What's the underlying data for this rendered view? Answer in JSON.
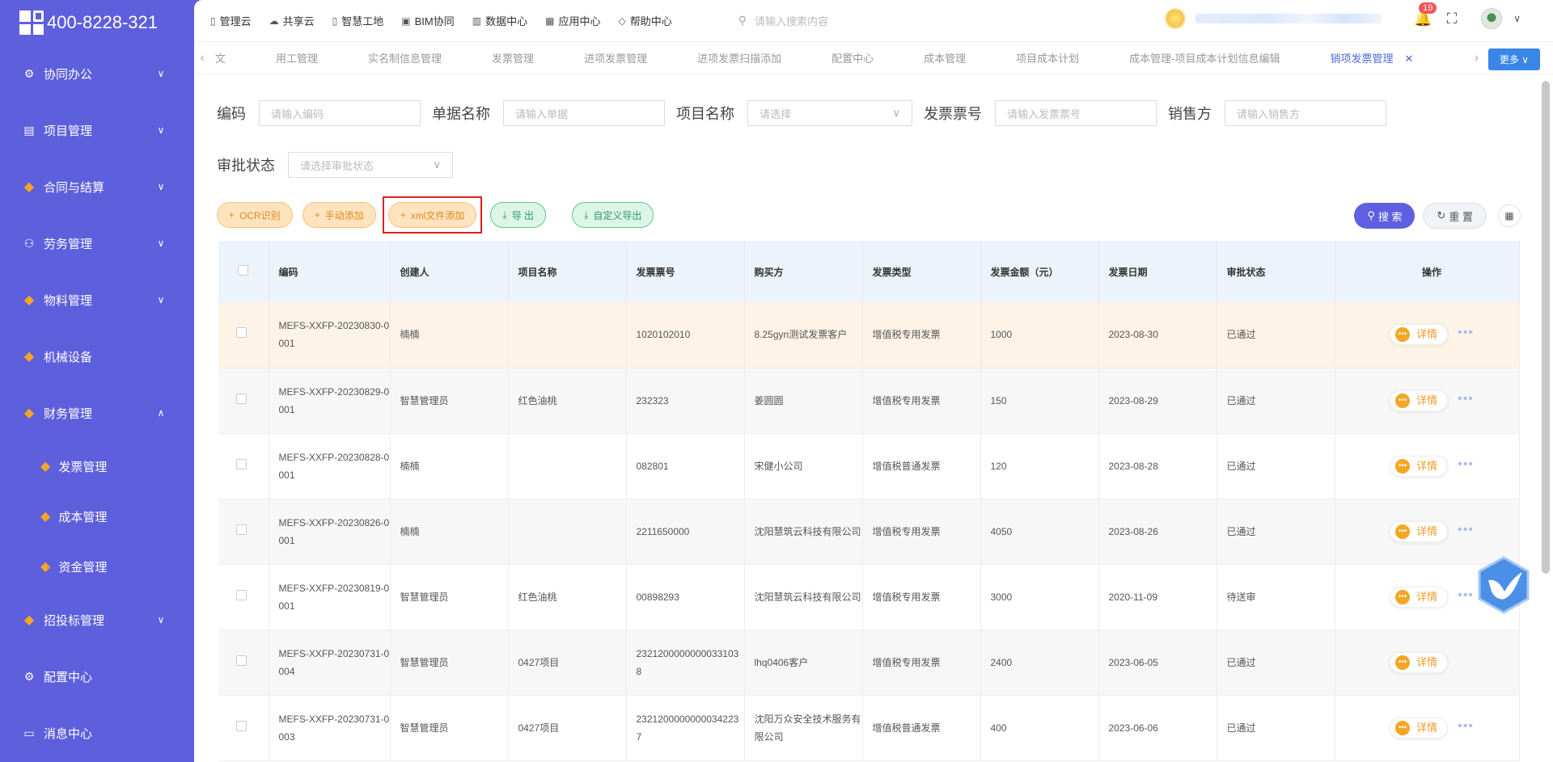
{
  "brand": {
    "phone": "400-8228-321"
  },
  "sidebar": {
    "items": [
      {
        "label": "协同办公",
        "icon": "gear-icon",
        "chevron": "down"
      },
      {
        "label": "项目管理",
        "icon": "book-icon",
        "chevron": "down"
      },
      {
        "label": "合同与结算",
        "icon": "gem-icon",
        "chevron": "down"
      },
      {
        "label": "劳务管理",
        "icon": "user-icon",
        "chevron": "down"
      },
      {
        "label": "物料管理",
        "icon": "gem-icon",
        "chevron": "down"
      },
      {
        "label": "机械设备",
        "icon": "gem-icon",
        "chevron": ""
      },
      {
        "label": "财务管理",
        "icon": "gem-icon",
        "chevron": "up"
      }
    ],
    "subitems": [
      {
        "label": "发票管理"
      },
      {
        "label": "成本管理"
      },
      {
        "label": "资金管理"
      }
    ],
    "bottom_items": [
      {
        "label": "招投标管理",
        "icon": "gem-icon",
        "chevron": "down"
      },
      {
        "label": "配置中心",
        "icon": "gear-icon",
        "chevron": ""
      },
      {
        "label": "消息中心",
        "icon": "chat-icon",
        "chevron": ""
      }
    ]
  },
  "topbar": {
    "links": [
      {
        "label": "管理云",
        "icon": "doc-icon"
      },
      {
        "label": "共享云",
        "icon": "cloud-icon"
      },
      {
        "label": "智慧工地",
        "icon": "doc-icon"
      },
      {
        "label": "BIM协同",
        "icon": "cube-icon"
      },
      {
        "label": "数据中心",
        "icon": "chart-icon"
      },
      {
        "label": "应用中心",
        "icon": "grid-icon"
      },
      {
        "label": "帮助中心",
        "icon": "diamond-icon"
      }
    ],
    "search_placeholder": "请输入搜索内容",
    "notification_count": "19"
  },
  "tabs": {
    "items": [
      "文",
      "用工管理",
      "实名制信息管理",
      "发票管理",
      "进项发票管理",
      "进项发票扫描添加",
      "配置中心",
      "成本管理",
      "项目成本计划",
      "成本管理-项目成本计划信息编辑"
    ],
    "active": "销项发票管理",
    "more_label": "更多"
  },
  "filters": {
    "code_label": "编码",
    "code_placeholder": "请输入编码",
    "docname_label": "单据名称",
    "docname_placeholder": "请输入单据",
    "project_label": "项目名称",
    "project_placeholder": "请选择",
    "invoice_label": "发票票号",
    "invoice_placeholder": "请输入发票票号",
    "seller_label": "销售方",
    "seller_placeholder": "请输入销售方",
    "status_label": "审批状态",
    "status_placeholder": "请选择审批状态"
  },
  "toolbar": {
    "ocr": "OCR识别",
    "manual": "手动添加",
    "xml": "xml文件添加",
    "export": "导 出",
    "custom_export": "自定义导出",
    "search": "搜 索",
    "reset": "重 置"
  },
  "table": {
    "headers": [
      "编码",
      "创建人",
      "项目名称",
      "发票票号",
      "购买方",
      "发票类型",
      "发票金额（元）",
      "发票日期",
      "审批状态",
      "操作"
    ],
    "detail_label": "详情",
    "rows": [
      {
        "code": "MEFS-XXFP-20230830-0001",
        "creator": "楠楠",
        "project": "",
        "invoice": "1020102010",
        "buyer": "8.25gyn测试发票客户",
        "type": "增值税专用发票",
        "amount": "1000",
        "date": "2023-08-30",
        "status": "已通过"
      },
      {
        "code": "MEFS-XXFP-20230829-0001",
        "creator": "智慧管理员",
        "project": "红色油桃",
        "invoice": "232323",
        "buyer": "姜圆圆",
        "type": "增值税专用发票",
        "amount": "150",
        "date": "2023-08-29",
        "status": "已通过"
      },
      {
        "code": "MEFS-XXFP-20230828-0001",
        "creator": "楠楠",
        "project": "",
        "invoice": "082801",
        "buyer": "宋健小公司",
        "type": "增值税普通发票",
        "amount": "120",
        "date": "2023-08-28",
        "status": "已通过"
      },
      {
        "code": "MEFS-XXFP-20230826-0001",
        "creator": "楠楠",
        "project": "",
        "invoice": "2211650000",
        "buyer": "沈阳慧筑云科技有限公司",
        "type": "增值税专用发票",
        "amount": "4050",
        "date": "2023-08-26",
        "status": "已通过"
      },
      {
        "code": "MEFS-XXFP-20230819-0001",
        "creator": "智慧管理员",
        "project": "红色油桃",
        "invoice": "00898293",
        "buyer": "沈阳慧筑云科技有限公司",
        "type": "增值税专用发票",
        "amount": "3000",
        "date": "2020-11-09",
        "status": "待送审"
      },
      {
        "code": "MEFS-XXFP-20230731-0004",
        "creator": "智慧管理员",
        "project": "0427项目",
        "invoice": "23212000000000331038",
        "buyer": "lhq0406客户",
        "type": "增值税专用发票",
        "amount": "2400",
        "date": "2023-06-05",
        "status": "已通过"
      },
      {
        "code": "MEFS-XXFP-20230731-0003",
        "creator": "智慧管理员",
        "project": "0427项目",
        "invoice": "23212000000000342237",
        "buyer": "沈阳万众安全技术服务有限公司",
        "type": "增值税普通发票",
        "amount": "400",
        "date": "2023-06-06",
        "status": "已通过"
      }
    ]
  },
  "colors": {
    "sidebar": "#5e5fdd",
    "accent": "#5f5fe0",
    "orange": "#f5a623",
    "highlight_row": "#fdf3e6"
  }
}
